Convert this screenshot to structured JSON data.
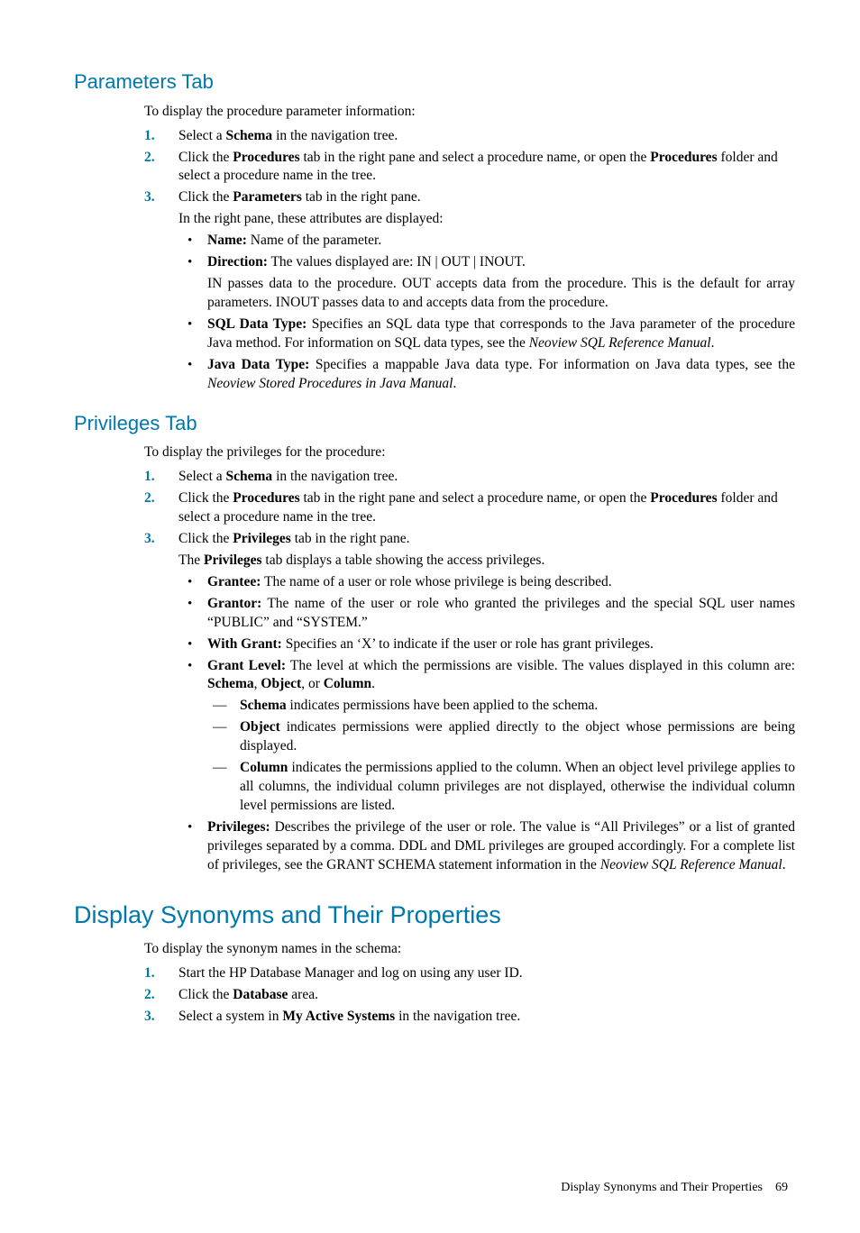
{
  "sec1": {
    "title": "Parameters Tab",
    "lead": "To display the procedure parameter information:",
    "s1_pre": "Select a ",
    "s1_b1": "Schema",
    "s1_post": " in the navigation tree.",
    "s2_pre": "Click the ",
    "s2_b1": "Procedures",
    "s2_mid": " tab in the right pane and select a procedure name, or open the ",
    "s2_b2": "Procedures",
    "s2_post": " folder and select a procedure name in the tree.",
    "s3_pre": "Click the ",
    "s3_b1": "Parameters",
    "s3_post": " tab in the right pane.",
    "s3_p2": "In the right pane, these attributes are displayed:",
    "b_name_lbl": "Name:",
    "b_name_txt": " Name of the parameter.",
    "b_dir_lbl": "Direction:",
    "b_dir_txt": " The values displayed are: IN | OUT | INOUT.",
    "b_dir_p2": "IN passes data to the procedure. OUT accepts data from the procedure. This is the default for array parameters. INOUT passes data to and accepts data from the procedure.",
    "b_sql_lbl": "SQL Data Type:",
    "b_sql_txt": " Specifies an SQL data type that corresponds to the Java parameter of the procedure Java method. For information on SQL data types, see the ",
    "b_sql_i": "Neoview SQL Reference Manual",
    "b_sql_end": ".",
    "b_java_lbl": "Java Data Type:",
    "b_java_txt": " Specifies a mappable Java data type. For information on Java data types, see the ",
    "b_java_i": "Neoview Stored Procedures in Java Manual",
    "b_java_end": "."
  },
  "sec2": {
    "title": "Privileges Tab",
    "lead": "To display the privileges for the procedure:",
    "s1_pre": "Select a ",
    "s1_b1": "Schema",
    "s1_post": " in the navigation tree.",
    "s2_pre": "Click the ",
    "s2_b1": "Procedures",
    "s2_mid": " tab in the right pane and select a procedure name, or open the ",
    "s2_b2": "Procedures",
    "s2_post": " folder and select a procedure name in the tree.",
    "s3_pre": "Click the ",
    "s3_b1": "Privileges",
    "s3_post": " tab in the right pane.",
    "s3_p2a": "The ",
    "s3_p2b": "Privileges",
    "s3_p2c": " tab displays a table showing the access privileges.",
    "b_grantee_lbl": "Grantee:",
    "b_grantee_txt": " The name of a user or role whose privilege is being described.",
    "b_grantor_lbl": "Grantor:",
    "b_grantor_txt": " The name of the user or role who granted the privileges and the special SQL user names “PUBLIC” and “SYSTEM.”",
    "b_withgrant_lbl": "With Grant:",
    "b_withgrant_txt": " Specifies an ‘X’ to indicate if the user or role has grant privileges.",
    "b_glevel_lbl": "Grant Level:",
    "b_glevel_txt1": " The level at which the permissions are visible. The values displayed in this column are: ",
    "b_glevel_b1": "Schema",
    "b_glevel_c1": ", ",
    "b_glevel_b2": "Object",
    "b_glevel_c2": ", or ",
    "b_glevel_b3": "Column",
    "b_glevel_end": ".",
    "d_schema_b": "Schema",
    "d_schema_txt": " indicates permissions have been applied to the schema.",
    "d_object_b": "Object",
    "d_object_txt": " indicates permissions were applied directly to the object whose permissions are being displayed.",
    "d_column_b": "Column",
    "d_column_txt": " indicates the permissions applied to the column. When an object level privilege applies to all columns, the individual column privileges are not displayed, otherwise the individual column level permissions are listed.",
    "b_priv_lbl": "Privileges:",
    "b_priv_txt": " Describes the privilege of the user or role. The value is “All Privileges” or a list of granted privileges separated by a comma. DDL and DML privileges are grouped accordingly. For a complete list of privileges, see the GRANT SCHEMA statement information in the ",
    "b_priv_i": "Neoview SQL Reference Manual",
    "b_priv_end": "."
  },
  "sec3": {
    "title": "Display Synonyms and Their Properties",
    "lead": "To display the synonym names in the schema:",
    "s1": "Start the HP Database Manager and log on using any user ID.",
    "s2_pre": "Click the ",
    "s2_b1": "Database",
    "s2_post": " area.",
    "s3_pre": "Select a system in ",
    "s3_b1": "My Active Systems",
    "s3_post": " in the navigation tree."
  },
  "nums": {
    "n1": "1.",
    "n2": "2.",
    "n3": "3."
  },
  "footer": {
    "text": "Display Synonyms and Their Properties",
    "page": "69"
  }
}
